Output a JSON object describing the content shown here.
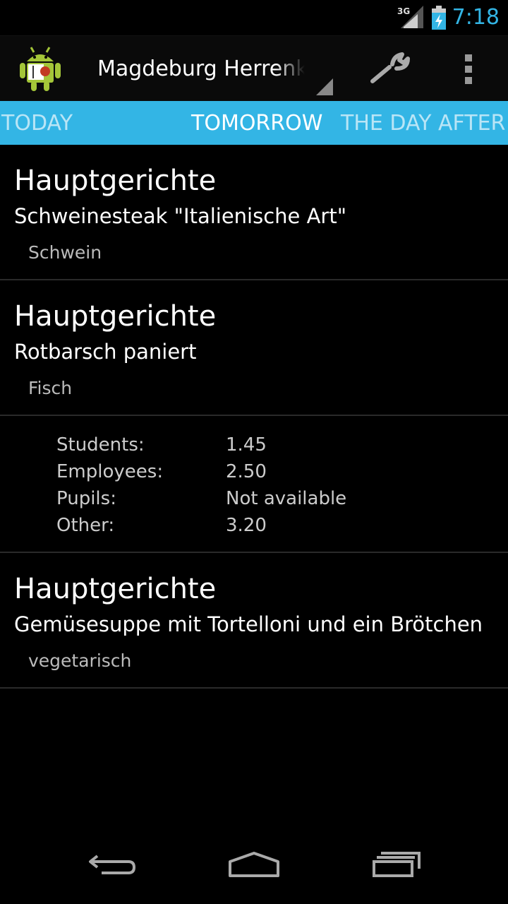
{
  "status_bar": {
    "network_label": "3G",
    "time": "7:18",
    "accent_color": "#33b5e5"
  },
  "action_bar": {
    "title": "Magdeburg Herrenkrug",
    "icons": [
      "android-logo-icon",
      "wrench-icon",
      "overflow-menu-icon"
    ]
  },
  "tabs": [
    {
      "label": "TODAY",
      "selected": false
    },
    {
      "label": "TOMORROW",
      "selected": true
    },
    {
      "label": "THE DAY AFTER",
      "selected": false
    }
  ],
  "meals": [
    {
      "category": "Hauptgerichte",
      "name": "Schweinesteak \"Italienische Art\"",
      "tag": "Schwein"
    },
    {
      "category": "Hauptgerichte",
      "name": "Rotbarsch paniert",
      "tag": "Fisch"
    },
    {
      "category": "Hauptgerichte",
      "name": "Gemüsesuppe mit Tortelloni und ein Brötchen",
      "tag": "vegetarisch"
    }
  ],
  "prices": [
    {
      "label": "Students:",
      "value": "1.45"
    },
    {
      "label": "Employees:",
      "value": "2.50"
    },
    {
      "label": "Pupils:",
      "value": "Not available"
    },
    {
      "label": "Other:",
      "value": "3.20"
    }
  ],
  "nav_bar": {
    "icons": [
      "back-icon",
      "home-icon",
      "recent-apps-icon"
    ]
  }
}
